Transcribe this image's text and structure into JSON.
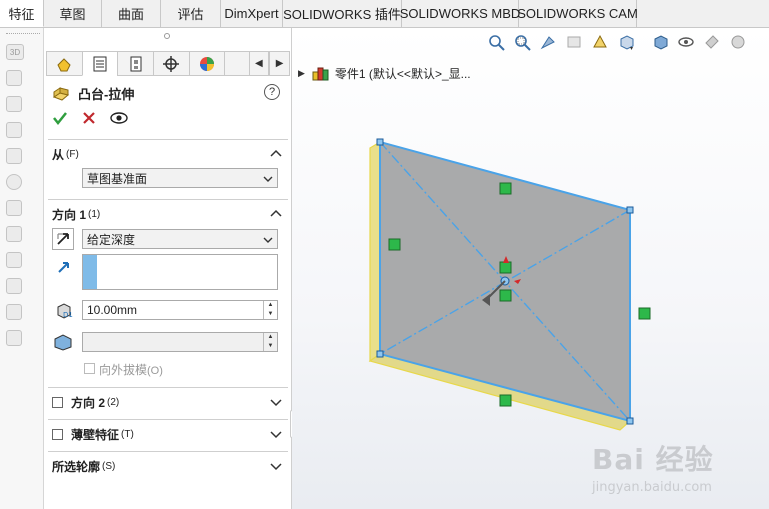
{
  "tabs": [
    {
      "label": "特征",
      "active": true
    },
    {
      "label": "草图",
      "active": false
    },
    {
      "label": "曲面",
      "active": false
    },
    {
      "label": "评估",
      "active": false
    },
    {
      "label": "DimXpert",
      "active": false
    },
    {
      "label": "SOLIDWORKS 插件",
      "active": false
    },
    {
      "label": "SOLIDWORKS MBD",
      "active": false
    },
    {
      "label": "SOLIDWORKS CAM",
      "active": false
    }
  ],
  "left_toolbar": {
    "top_label": "3D",
    "icons": [
      "extrude-icon",
      "revolve-icon",
      "sweep-icon",
      "loft-icon",
      "hole-icon",
      "fillet-icon",
      "pattern-icon",
      "rib-icon",
      "shell-icon",
      "draft-icon",
      "mirror-icon",
      "reference-icon"
    ]
  },
  "property_manager": {
    "tab_icons": [
      "feature-manager-icon",
      "property-manager-icon",
      "configuration-manager-icon",
      "dimxpert-icon",
      "appearance-icon"
    ],
    "title": "凸台-拉伸",
    "help": "?",
    "groups": {
      "from": {
        "label": "从",
        "shortcut": "(F)",
        "start_condition": "草图基准面"
      },
      "direction1": {
        "label": "方向 1",
        "shortcut": "(1)",
        "end_condition": "给定深度",
        "depth": "10.00mm",
        "draft_label": "向外拔模",
        "draft_shortcut": "(O)"
      },
      "direction2": {
        "label": "方向 2",
        "shortcut": "(2)"
      },
      "thin_feature": {
        "label": "薄壁特征",
        "shortcut": "(T)"
      },
      "selected_contours": {
        "label": "所选轮廓",
        "shortcut": "(S)"
      }
    }
  },
  "viewport": {
    "tree_item": "零件1  (默认<<默认>_显...",
    "watermark_main": "Bai 经验",
    "watermark_sub": "jingyan.baidu.com"
  },
  "colors": {
    "accept": "#2f9e3f",
    "cancel": "#c0282d",
    "selection_blue": "#4aa3e8",
    "preview_yellow": "#f0e060",
    "relation_green": "#2db84a"
  }
}
